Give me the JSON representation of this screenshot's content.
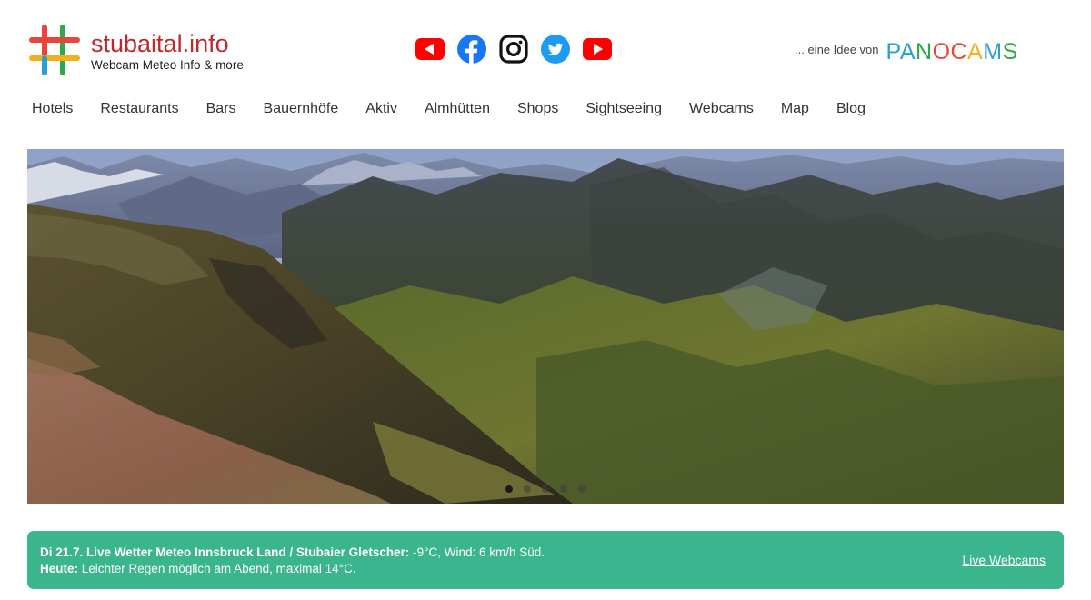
{
  "header": {
    "logo_title": "stubaital.info",
    "logo_subtitle": "Webcam Meteo Info & more",
    "idea_text": "... eine Idee von",
    "panocams_letters": [
      {
        "ch": "P",
        "color": "#2b9ed8"
      },
      {
        "ch": "A",
        "color": "#2b9ed8"
      },
      {
        "ch": "N",
        "color": "#2baa4a"
      },
      {
        "ch": "O",
        "color": "#e8453c"
      },
      {
        "ch": "C",
        "color": "#e8453c"
      },
      {
        "ch": "A",
        "color": "#f2b01e"
      },
      {
        "ch": "M",
        "color": "#2b9ed8"
      },
      {
        "ch": "S",
        "color": "#2baa4a"
      }
    ],
    "social_icons": [
      "video-icon",
      "facebook-icon",
      "instagram-icon",
      "twitter-icon",
      "youtube-icon"
    ]
  },
  "nav": {
    "items": [
      "Hotels",
      "Restaurants",
      "Bars",
      "Bauernhöfe",
      "Aktiv",
      "Almhütten",
      "Shops",
      "Sightseeing",
      "Webcams",
      "Map",
      "Blog"
    ]
  },
  "slider": {
    "slide_count": 5,
    "active_slide": 1
  },
  "weather": {
    "line1_bold": "Di 21.7. Live Wetter Meteo Innsbruck Land / Stubaier Gletscher:",
    "line1_rest": " -9°C, Wind: 6 km/h Süd.",
    "line2_bold": "Heute:",
    "line2_rest": " Leichter Regen möglich am Abend, maximal 14°C.",
    "link_label": "Live Webcams"
  },
  "colors": {
    "brand_red": "#c0282d",
    "weather_bg": "#3bb58e"
  }
}
